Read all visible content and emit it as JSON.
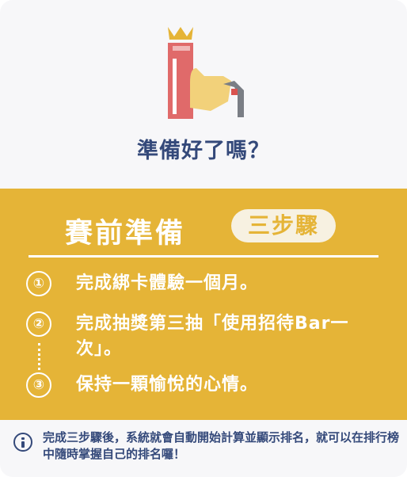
{
  "hero": {
    "illustration": "hand-holding-card-with-crown-icon",
    "title": "準備好了嗎？"
  },
  "panel": {
    "title": "賽前準備",
    "badge": "三步驟",
    "steps": [
      {
        "num": "①",
        "text": "完成綁卡體驗一個月。"
      },
      {
        "num": "②",
        "text": "完成抽獎第三抽「使用招待Bar一次」。"
      },
      {
        "num": "③",
        "text": "保持一顆愉悅的心情。"
      }
    ]
  },
  "footer": {
    "icon": "info-icon",
    "note": "完成三步驟後，系統就會自動開始計算並顯示排名，就可以在排行榜中隨時掌握自己的排名囉！"
  },
  "colors": {
    "accent": "#e5b437",
    "text_primary": "#34497a",
    "card_bg": "#f7f7f9"
  }
}
